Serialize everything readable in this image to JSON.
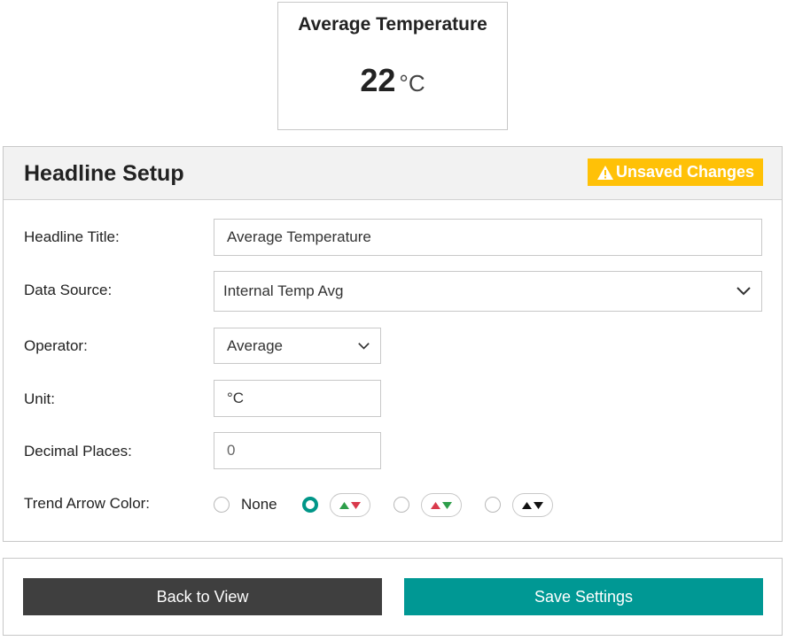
{
  "preview": {
    "title": "Average Temperature",
    "value": "22",
    "unit": "°C"
  },
  "setup": {
    "title": "Headline Setup",
    "unsaved_label": "Unsaved Changes",
    "fields": {
      "headline_title": {
        "label": "Headline Title:",
        "value": "Average Temperature"
      },
      "data_source": {
        "label": "Data Source:",
        "value": "Internal Temp Avg"
      },
      "operator": {
        "label": "Operator:",
        "value": "Average"
      },
      "unit": {
        "label": "Unit:",
        "value": "°C"
      },
      "decimal_places": {
        "label": "Decimal Places:",
        "placeholder": "0"
      },
      "trend_arrow_color": {
        "label": "Trend Arrow Color:",
        "none_label": "None",
        "options": [
          {
            "id": "none",
            "up": "",
            "down": "",
            "checked": false
          },
          {
            "id": "green-up-red-down",
            "up": "#2e9e4a",
            "down": "#d9394b",
            "checked": true
          },
          {
            "id": "red-up-green-down",
            "up": "#d9394b",
            "down": "#2e9e4a",
            "checked": false
          },
          {
            "id": "black",
            "up": "#111111",
            "down": "#111111",
            "checked": false
          }
        ]
      }
    }
  },
  "footer": {
    "back_label": "Back to View",
    "save_label": "Save Settings"
  },
  "colors": {
    "accent": "#009894",
    "warning": "#ffc107",
    "dark_button": "#3f3f3f"
  }
}
